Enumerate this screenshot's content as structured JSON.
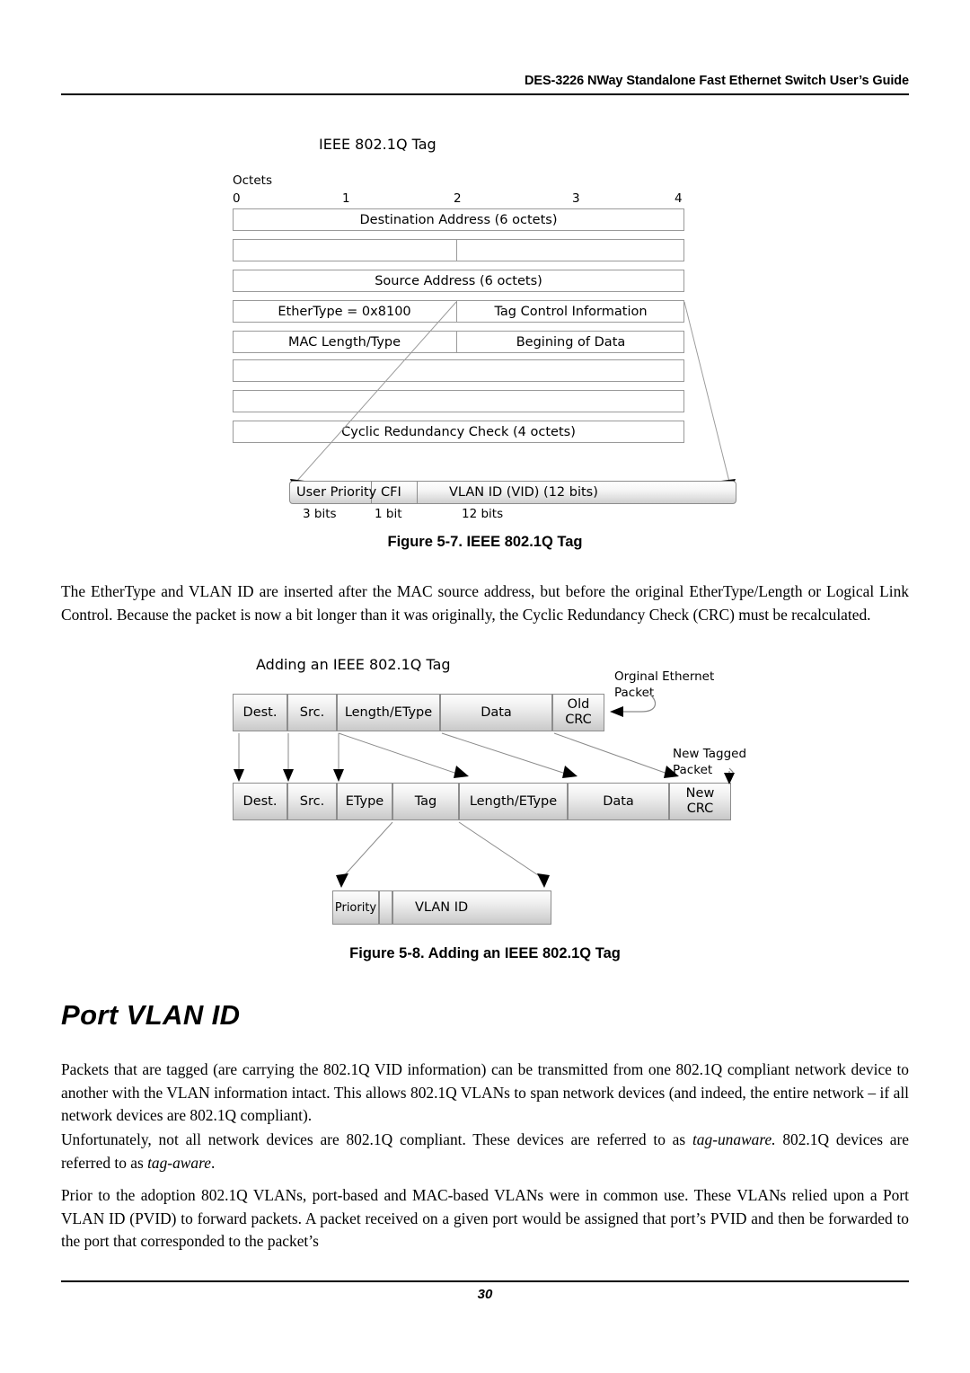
{
  "page": {
    "running_head": "DES-3226 NWay Standalone Fast Ethernet Switch User’s Guide",
    "page_number": "30"
  },
  "figure_5_7": {
    "diagram_title": "IEEE 802.1Q Tag",
    "octets_label": "Octets",
    "octet_ticks": [
      "0",
      "1",
      "2",
      "3",
      "4"
    ],
    "rows": [
      {
        "cells": [
          "Destination Address (6 octets)"
        ],
        "split": false
      },
      {
        "cells": [
          "",
          ""
        ],
        "split": true
      },
      {
        "cells": [
          "Source Address (6 octets)"
        ],
        "split": false
      },
      {
        "cells": [
          "EtherType = 0x8100",
          "Tag Control Information"
        ],
        "split": true
      },
      {
        "cells": [
          "MAC Length/Type",
          "Begining of Data"
        ],
        "split": true
      },
      {
        "cells": [
          ""
        ],
        "split": false
      },
      {
        "cells": [
          ""
        ],
        "split": false
      },
      {
        "cells": [
          "Cyclic Redundancy Check (4 octets)"
        ],
        "split": false
      }
    ],
    "tci_segments": [
      {
        "label": "User Priority",
        "bits": "3 bits"
      },
      {
        "label": "CFI",
        "bits": "1 bit"
      },
      {
        "label": "VLAN ID (VID) (12 bits)",
        "bits": "12 bits"
      }
    ],
    "caption": "Figure 5-7.  IEEE 802.1Q Tag"
  },
  "paragraphs": {
    "p1": "The EtherType and VLAN ID are inserted after the MAC source address, but before the original EtherType/Length or Logical Link Control. Because the packet is now a bit longer than it was originally, the Cyclic Redundancy Check (CRC) must be recalculated.",
    "p2": "Packets that are tagged (are carrying the 802.1Q VID information) can be transmitted from one 802.1Q compliant network device to another with the VLAN information intact. This allows 802.1Q VLANs to span network devices (and indeed, the entire network – if all network devices are 802.1Q compliant).",
    "p3_a": "Unfortunately, not all network devices are 802.1Q compliant. These devices are referred to as ",
    "p3_i1": "tag-unaware.",
    "p3_b": "  802.1Q devices are referred to as ",
    "p3_i2": "tag-aware",
    "p3_c": ".",
    "p4": "Prior to the adoption 802.1Q VLANs, port-based and MAC-based VLANs were in common use. These VLANs relied upon a Port VLAN ID (PVID) to forward packets. A packet received on a given port would be assigned that port’s PVID and then be forwarded to the port that corresponded to the packet’s"
  },
  "figure_5_8": {
    "diagram_title": "Adding an IEEE 802.1Q Tag",
    "original_packet_note": "Orginal Ethernet\nPacket",
    "original_packet_note_l1": "Orginal Ethernet",
    "original_packet_note_l2": "Packet",
    "new_packet_note_l1": "New Tagged",
    "new_packet_note_l2": "Packet",
    "original_row": [
      "Dest.",
      "Src.",
      "Length/EType",
      "Data",
      "Old\nCRC"
    ],
    "original_row_cells": [
      {
        "label": "Dest."
      },
      {
        "label": "Src."
      },
      {
        "label": "Length/EType"
      },
      {
        "label": "Data"
      },
      {
        "label_l1": "Old",
        "label_l2": "CRC"
      }
    ],
    "tagged_row_cells": [
      {
        "label": "Dest."
      },
      {
        "label": "Src."
      },
      {
        "label": "EType"
      },
      {
        "label": "Tag"
      },
      {
        "label": "Length/EType"
      },
      {
        "label": "Data"
      },
      {
        "label_l1": "New",
        "label_l2": "CRC"
      }
    ],
    "tag_detail_cells": [
      {
        "label": "Priority"
      },
      {
        "label": ""
      },
      {
        "label": "VLAN ID"
      }
    ],
    "caption": "Figure 5-8.  Adding an IEEE 802.1Q Tag"
  },
  "section": {
    "port_vlan_id_heading": "Port VLAN ID"
  },
  "colors": {
    "rule": "#000000",
    "box_border": "#9a9a9a",
    "connector": "#8a8a8a",
    "arrow": "#000000"
  }
}
